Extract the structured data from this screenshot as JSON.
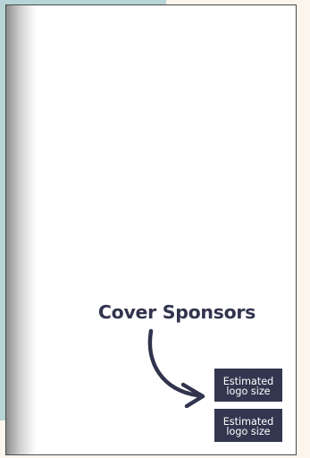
{
  "page": {
    "heading": "Cover Sponsors"
  },
  "logo_placeholders": [
    {
      "label": "Estimated logo size"
    },
    {
      "label": "Estimated logo size"
    }
  ],
  "colors": {
    "background": "#fbf5ec",
    "teal_block": "#b7d4d6",
    "text": "#32344e",
    "box_fill": "#33364f"
  },
  "icons": {
    "arrow": "curved-arrow-icon"
  }
}
